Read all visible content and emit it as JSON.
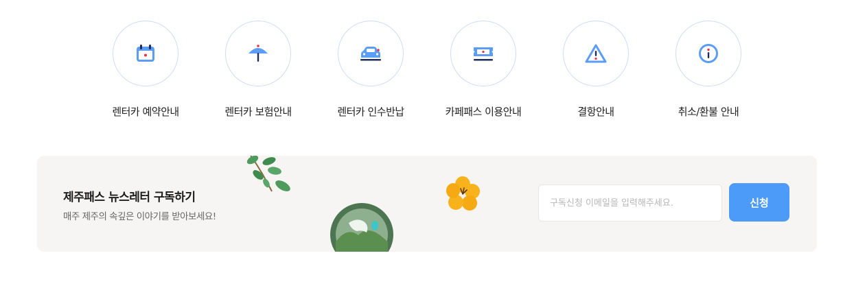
{
  "guides": [
    {
      "label": "렌터카 예약안내",
      "icon": "calendar-icon"
    },
    {
      "label": "렌터카 보험안내",
      "icon": "umbrella-icon"
    },
    {
      "label": "렌터카 인수반납",
      "icon": "car-icon"
    },
    {
      "label": "카페패스 이용안내",
      "icon": "ticket-icon"
    },
    {
      "label": "결항안내",
      "icon": "warning-icon"
    },
    {
      "label": "취소/환불 안내",
      "icon": "info-icon"
    }
  ],
  "newsletter": {
    "title": "제주패스 뉴스레터 구독하기",
    "subtitle": "매주 제주의 속깊은 이야기를 받아보세요!",
    "email_placeholder": "구독신청 이메일을 입력해주세요.",
    "email_value": "",
    "submit_label": "신청"
  },
  "colors": {
    "accent_blue": "#4d9bf9",
    "icon_blue": "#5b9cf5",
    "icon_navy": "#1f2d5a",
    "icon_red": "#e8334a",
    "panel_bg": "#f6f5f3"
  }
}
